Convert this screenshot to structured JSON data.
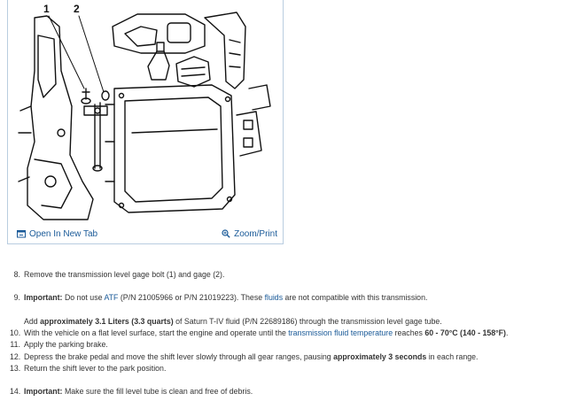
{
  "figure": {
    "callouts": [
      "1",
      "2"
    ],
    "open_tab_label": "Open In New Tab",
    "zoom_label": "Zoom/Print",
    "open_icon": "open-tab-icon",
    "zoom_icon": "magnifier-icon"
  },
  "steps": [
    {
      "num": "8.",
      "text": "Remove the transmission level gage bolt (1) and gage (2)."
    },
    {
      "num": "9.",
      "bold": "Important:",
      "t1": " Do not use ",
      "link1": "ATF",
      "t2": " (P/N 21005966 or P/N 21019223). These ",
      "link2": "fluids",
      "t3": " are not compatible with this transmission."
    },
    {
      "t1": "Add ",
      "bold": "approximately 3.1 Liters (3.3 quarts)",
      "t2": " of Saturn T-IV fluid (P/N 22689186) through the transmission level gage tube."
    },
    {
      "num": "10.",
      "t1": "With the vehicle on a flat level surface, start the engine and operate until the ",
      "link1": "transmission fluid temperature",
      "t2": " reaches ",
      "bold": "60 - 70°C (140 - 158°F)",
      "t3": "."
    },
    {
      "num": "11.",
      "text": "Apply the parking brake."
    },
    {
      "num": "12.",
      "t1": "Depress the brake pedal and move the shift lever slowly through all gear ranges, pausing ",
      "bold": "approximately 3 seconds",
      "t2": " in each range."
    },
    {
      "num": "13.",
      "text": "Return the shift lever to the park position."
    },
    {
      "num": "14.",
      "bold": "Important:",
      "t1": " Make sure the fill level tube is clean and free of debris."
    }
  ]
}
